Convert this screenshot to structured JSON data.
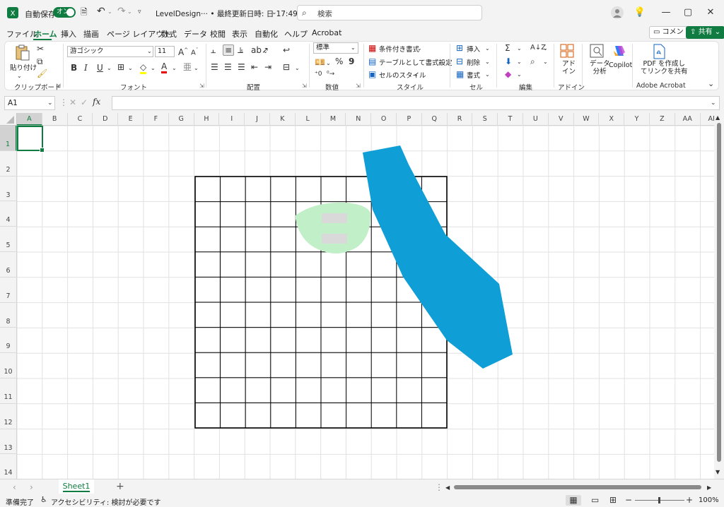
{
  "titlebar": {
    "autosave_label": "自動保存",
    "autosave_state": "オン",
    "doc_title": "LevelDesign··· • 最終更新日時: 日 17:49",
    "search_placeholder": "検索"
  },
  "tabs": [
    "ファイル",
    "ホーム",
    "挿入",
    "描画",
    "ページ レイアウト",
    "数式",
    "データ",
    "校閲",
    "表示",
    "自動化",
    "ヘルプ",
    "Acrobat"
  ],
  "active_tab": "ホーム",
  "top_buttons": {
    "comment": "コメント",
    "share": "共有"
  },
  "ribbon": {
    "clipboard": {
      "paste": "貼り付け",
      "label": "クリップボード"
    },
    "font": {
      "name": "游ゴシック",
      "size": "11",
      "label": "フォント"
    },
    "alignment": {
      "label": "配置"
    },
    "number": {
      "format": "標準",
      "label": "数値"
    },
    "styles": {
      "conditional": "条件付き書式",
      "as_table": "テーブルとして書式設定",
      "cell_styles": "セルのスタイル",
      "label": "スタイル"
    },
    "cells": {
      "insert": "挿入",
      "delete": "削除",
      "format": "書式",
      "label": "セル"
    },
    "editing": {
      "label": "編集"
    },
    "addins": {
      "btn": "アド\nイン",
      "label": "アドイン"
    },
    "analysis": {
      "btn": "データ\n分析"
    },
    "copilot": {
      "btn": "Copilot"
    },
    "acrobat": {
      "btn": "PDF を作成し\nてリンクを共有",
      "label": "Adobe Acrobat"
    }
  },
  "formula_bar": {
    "name_box": "A1",
    "fx": "fx",
    "value": ""
  },
  "columns": [
    "A",
    "B",
    "C",
    "D",
    "E",
    "F",
    "G",
    "H",
    "I",
    "J",
    "K",
    "L",
    "M",
    "N",
    "O",
    "P",
    "Q",
    "R",
    "S",
    "T",
    "U",
    "V",
    "W",
    "X",
    "Y",
    "Z",
    "AA",
    "AB"
  ],
  "rows": [
    "1",
    "2",
    "3",
    "4",
    "5",
    "6",
    "7",
    "8",
    "9",
    "10",
    "11",
    "12",
    "13",
    "14"
  ],
  "sheet_tab": "Sheet1",
  "status": {
    "ready": "準備完了",
    "accessibility": "アクセシビリティ: 検討が必要です",
    "zoom": "100%"
  },
  "colors": {
    "accent": "#107c41",
    "blue_shape": "#0f9ed5",
    "green_shape": "#c1f0c8",
    "gray_block": "#d9d9d9"
  }
}
